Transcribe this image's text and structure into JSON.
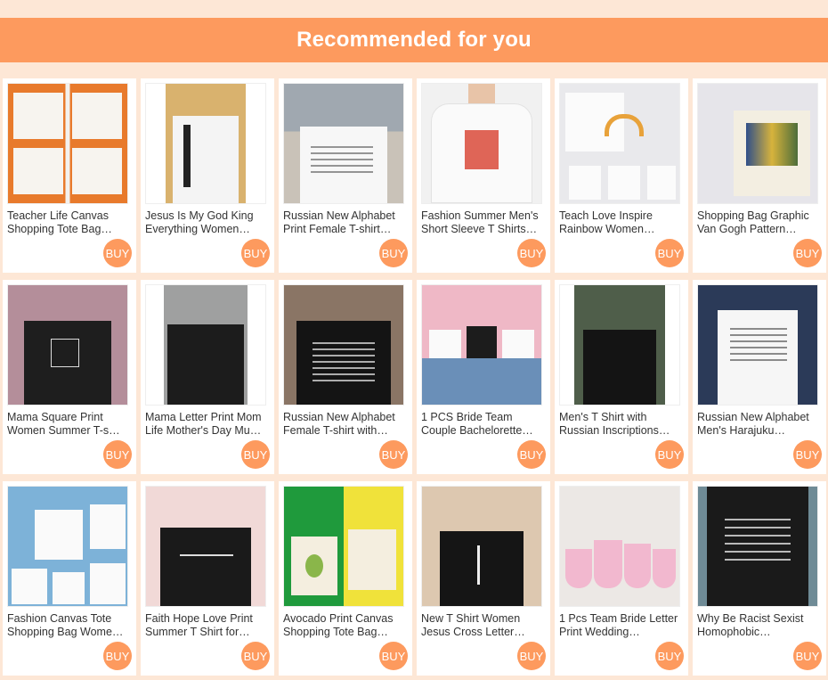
{
  "header": {
    "title": "Recommended for you"
  },
  "buy_label": "BUY",
  "colors": {
    "accent": "#fd9a5e",
    "background": "#fde7d6"
  },
  "products": [
    {
      "title": "Teacher Life Canvas Shopping Tote Bag…"
    },
    {
      "title": "Jesus Is My God King Everything Women…"
    },
    {
      "title": "Russian New Alphabet Print Female T-shirt…"
    },
    {
      "title": "Fashion Summer Men's Short Sleeve T Shirts…"
    },
    {
      "title": "Teach Love Inspire Rainbow Women…"
    },
    {
      "title": "Shopping Bag Graphic Van Gogh Pattern…"
    },
    {
      "title": "Mama Square Print Women Summer T-s…"
    },
    {
      "title": "Mama Letter Print Mom Life Mother's Day Mu…"
    },
    {
      "title": "Russian New Alphabet Female T-shirt with…"
    },
    {
      "title": "1 PCS Bride Team Couple Bachelorette…"
    },
    {
      "title": "Men's T Shirt with Russian Inscriptions…"
    },
    {
      "title": "Russian New Alphabet Men's Harajuku…"
    },
    {
      "title": "Fashion Canvas Tote Shopping Bag Wome…"
    },
    {
      "title": "Faith Hope Love Print Summer T Shirt for…"
    },
    {
      "title": "Avocado Print Canvas Shopping Tote Bag…"
    },
    {
      "title": "New T Shirt Women Jesus Cross Letter…"
    },
    {
      "title": "1 Pcs Team Bride Letter Print Wedding…"
    },
    {
      "title": "Why Be Racist Sexist Homophobic…"
    }
  ]
}
